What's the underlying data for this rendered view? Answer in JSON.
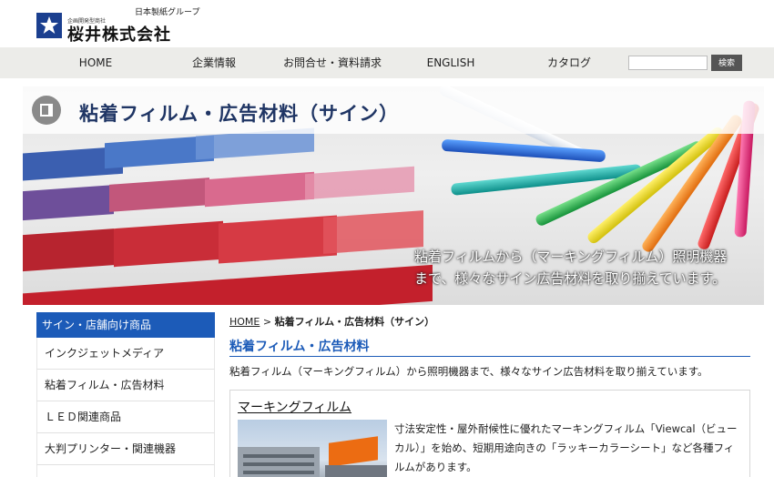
{
  "header": {
    "group_label": "日本製紙グループ",
    "logo_sub": "企画開発型商社",
    "company_name": "桜井株式会社"
  },
  "nav": {
    "items": [
      "HOME",
      "企業情報",
      "お問合せ・資料請求",
      "ENGLISH",
      "カタログ"
    ],
    "search_value": "",
    "search_button": "検索"
  },
  "hero": {
    "title": "粘着フィルム・広告材料（サイン）",
    "caption_line1": "粘着フィルムから（マーキングフィルム）照明機器",
    "caption_line2": "まで、様々なサイン広告材料を取り揃えています。"
  },
  "sidebar": {
    "header": "サイン・店舗向け商品",
    "items": [
      "インクジェットメディア",
      "粘着フィルム・広告材料",
      "ＬＥＤ関連商品",
      "大判プリンター・関連機器"
    ]
  },
  "breadcrumb": {
    "home": "HOME",
    "separator": ">",
    "current": "粘着フィルム・広告材料（サイン）"
  },
  "main": {
    "section_title": "粘着フィルム・広告材料",
    "lead": "粘着フィルム（マーキングフィルム）から照明機器まで、様々なサイン広告材料を取り揃えています。",
    "card": {
      "title": "マーキングフィルム",
      "text": "寸法安定性・屋外耐候性に優れたマーキングフィルム「Viewcal（ビューカル）」を始め、短期用途向きの「ラッキーカラーシート」など各種フィルムがあります。"
    }
  },
  "colors": {
    "accent": "#1c5bb8",
    "nav_bg": "#ecece9",
    "logo_blue": "#1b3f8f"
  }
}
